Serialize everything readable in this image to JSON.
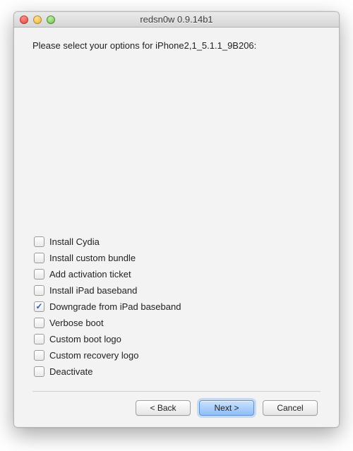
{
  "window": {
    "title": "redsn0w 0.9.14b1"
  },
  "prompt": "Please select your options for iPhone2,1_5.1.1_9B206:",
  "options": [
    {
      "label": "Install Cydia",
      "checked": false
    },
    {
      "label": "Install custom bundle",
      "checked": false
    },
    {
      "label": "Add activation ticket",
      "checked": false
    },
    {
      "label": "Install iPad baseband",
      "checked": false
    },
    {
      "label": "Downgrade from iPad baseband",
      "checked": true
    },
    {
      "label": "Verbose boot",
      "checked": false
    },
    {
      "label": "Custom boot logo",
      "checked": false
    },
    {
      "label": "Custom recovery logo",
      "checked": false
    },
    {
      "label": "Deactivate",
      "checked": false
    }
  ],
  "buttons": {
    "back": "< Back",
    "next": "Next >",
    "cancel": "Cancel"
  }
}
